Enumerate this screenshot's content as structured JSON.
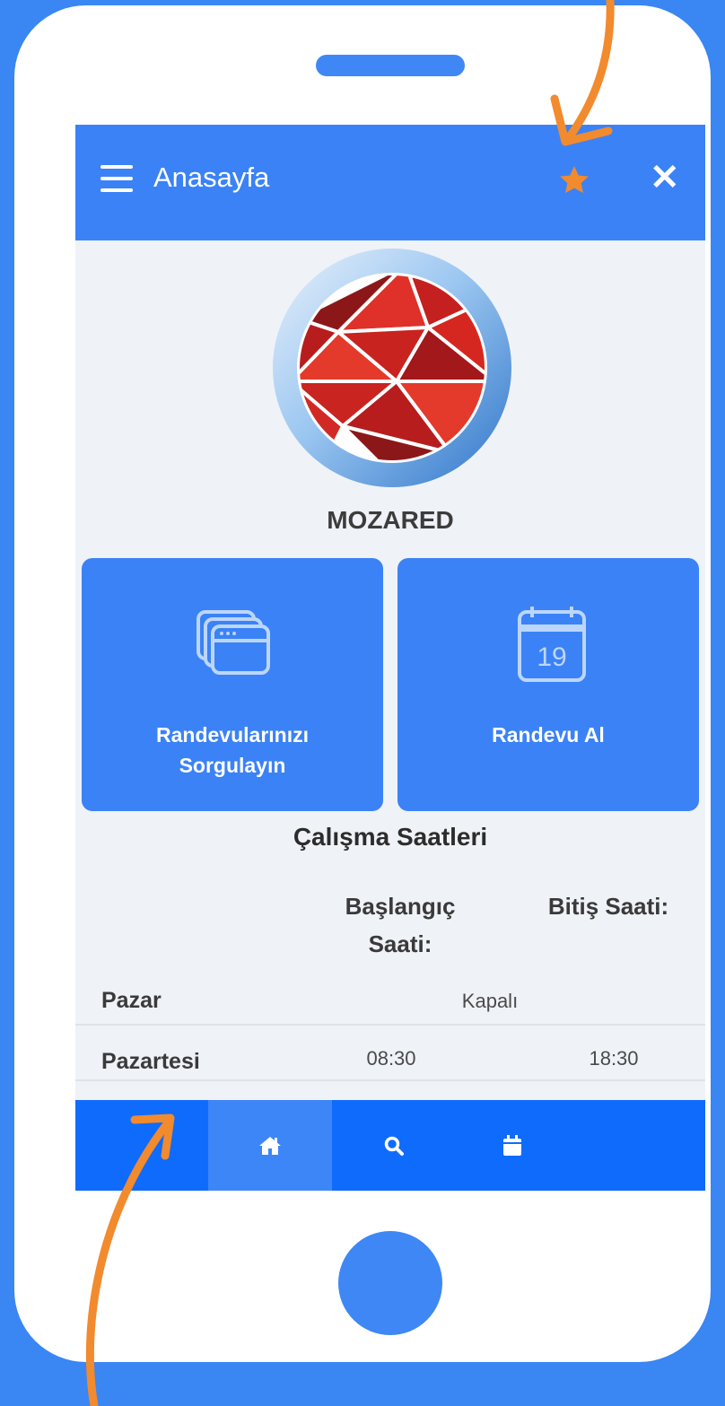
{
  "header": {
    "title": "Anasayfa"
  },
  "brand": {
    "name": "MOZARED"
  },
  "tiles": [
    {
      "label_line1": "Randevularınızı",
      "label_line2": "Sorgulayın",
      "icon": "browser-windows-icon"
    },
    {
      "label_line1": "Randevu Al",
      "label_line2": "",
      "icon": "calendar-icon",
      "calendar_day": "19"
    }
  ],
  "hours": {
    "title": "Çalışma Saatleri",
    "col_start_line1": "Başlangıç",
    "col_start_line2": "Saati:",
    "col_end": "Bitiş Saati:",
    "rows": [
      {
        "day": "Pazar",
        "closed": "Kapalı"
      },
      {
        "day": "Pazartesi",
        "start": "08:30",
        "end": "18:30"
      }
    ]
  },
  "nav": {
    "items": [
      "home-icon",
      "search-icon",
      "calendar-icon"
    ],
    "active": "home-icon"
  },
  "colors": {
    "primary": "#3b82f6",
    "nav": "#0f6bfb",
    "accent_orange": "#f28a2e",
    "background": "#eff2f7"
  }
}
